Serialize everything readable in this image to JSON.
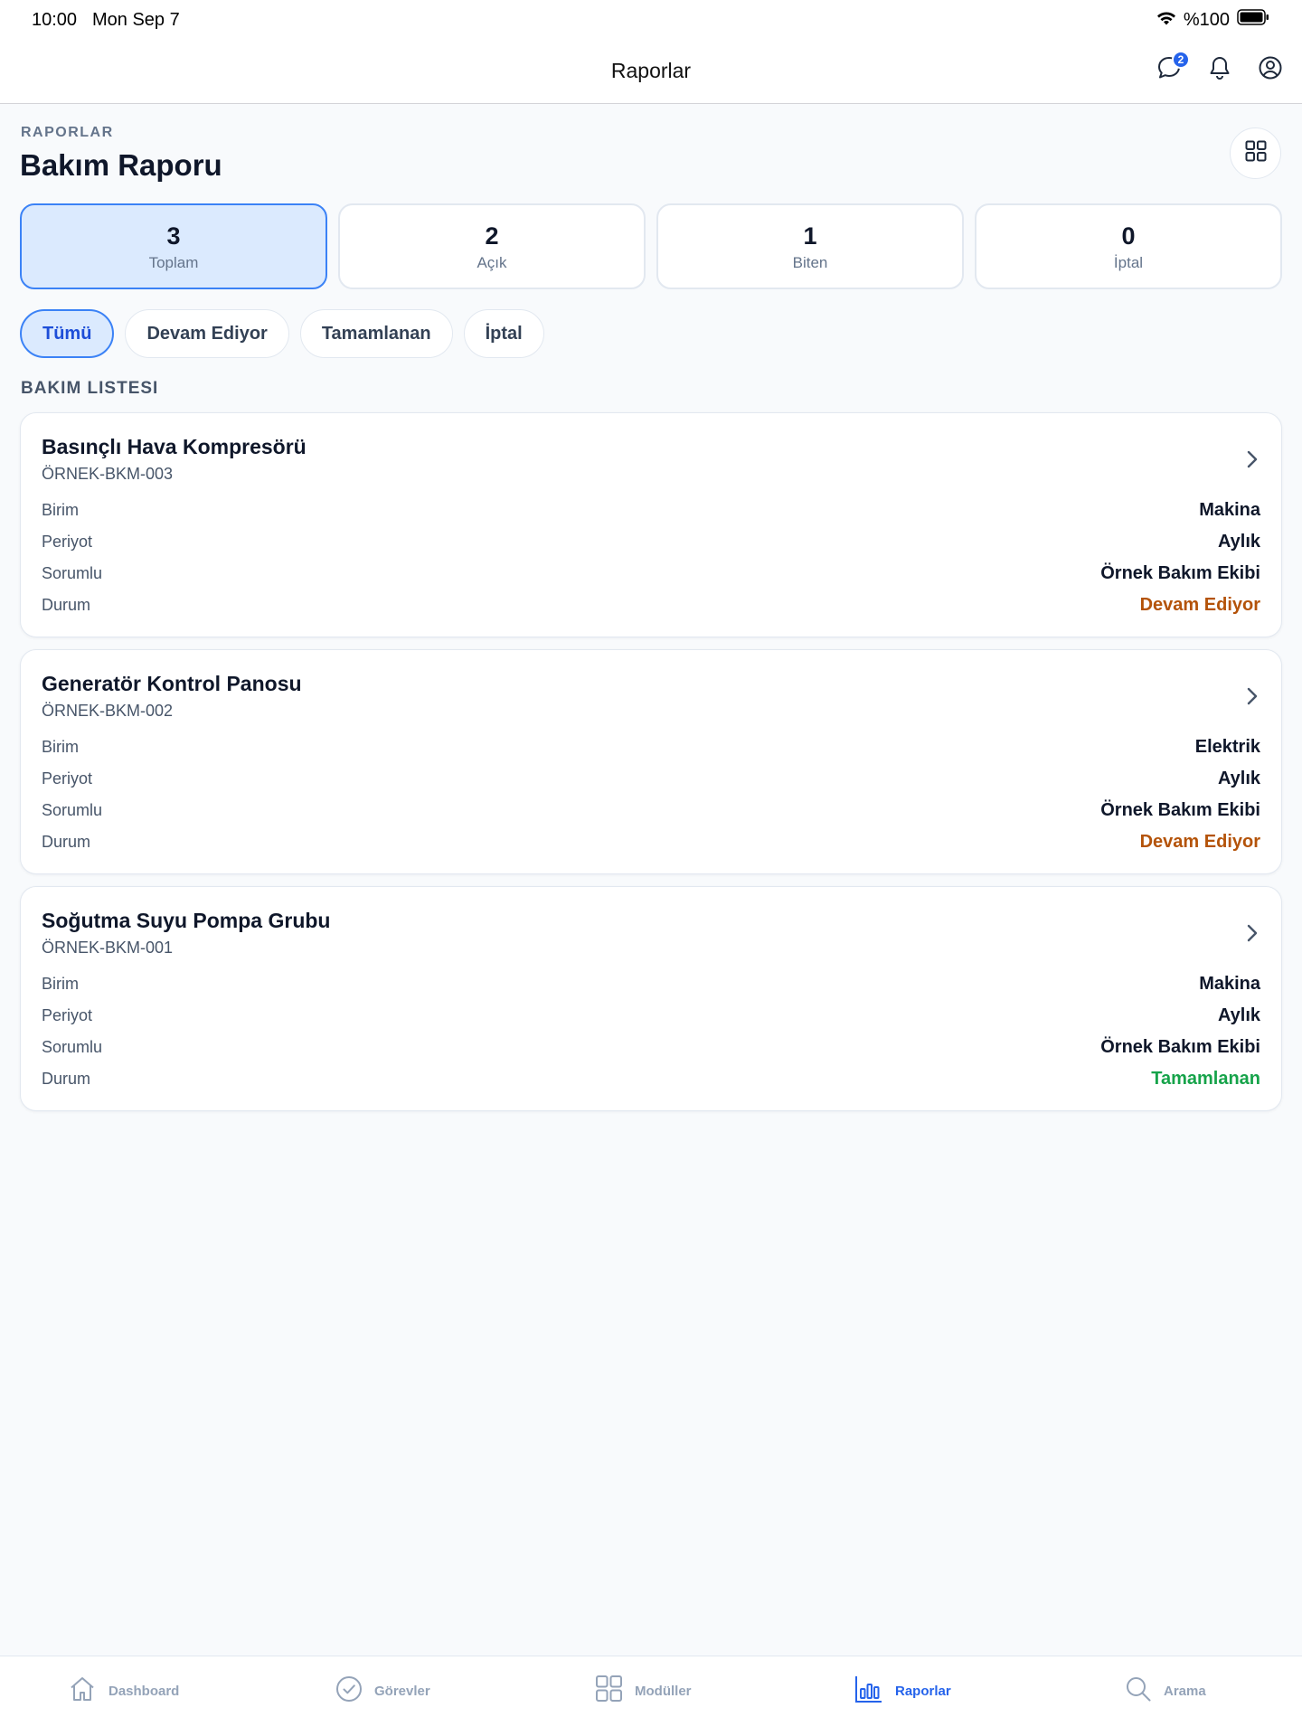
{
  "status_bar": {
    "time": "10:00",
    "date": "Mon Sep 7",
    "battery": "%100"
  },
  "nav": {
    "title": "Raporlar",
    "messages_badge": "2"
  },
  "header": {
    "eyebrow": "RAPORLAR",
    "title": "Bakım Raporu"
  },
  "stats": [
    {
      "value": "3",
      "label": "Toplam"
    },
    {
      "value": "2",
      "label": "Açık"
    },
    {
      "value": "1",
      "label": "Biten"
    },
    {
      "value": "0",
      "label": "İptal"
    }
  ],
  "filters": [
    "Tümü",
    "Devam Ediyor",
    "Tamamlanan",
    "İptal"
  ],
  "list_title": "BAKIM LISTESI",
  "field_labels": {
    "unit": "Birim",
    "period": "Periyot",
    "owner": "Sorumlu",
    "status": "Durum"
  },
  "items": [
    {
      "title": "Basınçlı Hava Kompresörü",
      "code": "ÖRNEK-BKM-003",
      "unit": "Makina",
      "period": "Aylık",
      "owner": "Örnek Bakım Ekibi",
      "status": "Devam Ediyor",
      "status_color": "#b45309"
    },
    {
      "title": "Generatör Kontrol Panosu",
      "code": "ÖRNEK-BKM-002",
      "unit": "Elektrik",
      "period": "Aylık",
      "owner": "Örnek Bakım Ekibi",
      "status": "Devam Ediyor",
      "status_color": "#b45309"
    },
    {
      "title": "Soğutma Suyu Pompa Grubu",
      "code": "ÖRNEK-BKM-001",
      "unit": "Makina",
      "period": "Aylık",
      "owner": "Örnek Bakım Ekibi",
      "status": "Tamamlanan",
      "status_color": "#16a34a"
    }
  ],
  "tabs": [
    {
      "label": "Dashboard",
      "icon": "home-icon"
    },
    {
      "label": "Görevler",
      "icon": "check-circle-icon"
    },
    {
      "label": "Modüller",
      "icon": "grid-icon"
    },
    {
      "label": "Raporlar",
      "icon": "bar-chart-icon"
    },
    {
      "label": "Arama",
      "icon": "search-icon"
    }
  ],
  "colors": {
    "accent": "#2563eb",
    "active_bg": "#dbeafe",
    "in_progress": "#b45309",
    "done": "#16a34a"
  }
}
